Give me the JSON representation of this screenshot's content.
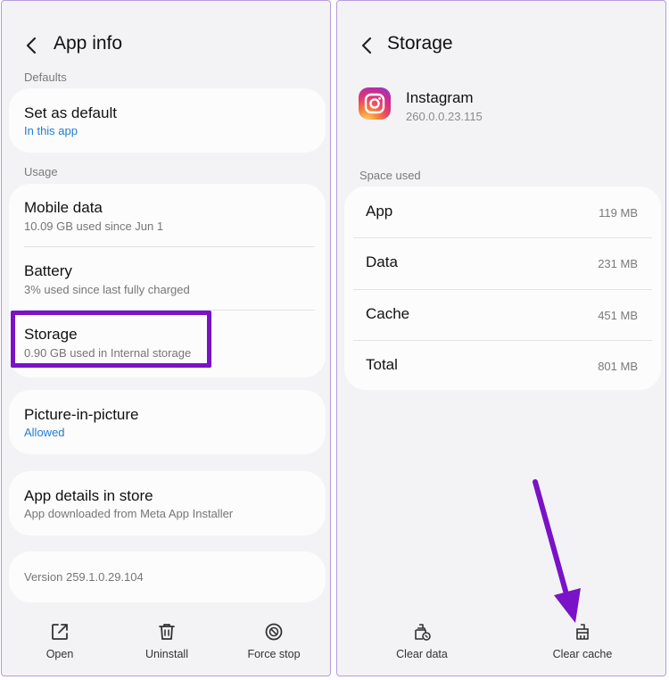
{
  "app_info": {
    "title": "App info",
    "defaults_label": "Defaults",
    "set_default": {
      "title": "Set as default",
      "subtitle": "In this app"
    },
    "usage_label": "Usage",
    "mobile_data": {
      "title": "Mobile data",
      "subtitle": "10.09 GB used since Jun 1"
    },
    "battery": {
      "title": "Battery",
      "subtitle": "3% used since last fully charged"
    },
    "storage": {
      "title": "Storage",
      "subtitle": "0.90 GB used in Internal storage"
    },
    "pip": {
      "title": "Picture-in-picture",
      "subtitle": "Allowed"
    },
    "store": {
      "title": "App details in store",
      "subtitle": "App downloaded from Meta App Installer"
    },
    "version": "Version 259.1.0.29.104",
    "bottom": {
      "open": "Open",
      "uninstall": "Uninstall",
      "force_stop": "Force stop"
    }
  },
  "storage": {
    "title": "Storage",
    "app_name": "Instagram",
    "app_version": "260.0.0.23.115",
    "space_used_label": "Space used",
    "rows": [
      {
        "label": "App",
        "value": "119 MB"
      },
      {
        "label": "Data",
        "value": "231 MB"
      },
      {
        "label": "Cache",
        "value": "451 MB"
      },
      {
        "label": "Total",
        "value": "801 MB"
      }
    ],
    "bottom": {
      "clear_data": "Clear data",
      "clear_cache": "Clear cache"
    }
  },
  "colors": {
    "highlight": "#7a12c7",
    "link_blue": "#1d7dd6",
    "background": "#f3f3f5"
  }
}
